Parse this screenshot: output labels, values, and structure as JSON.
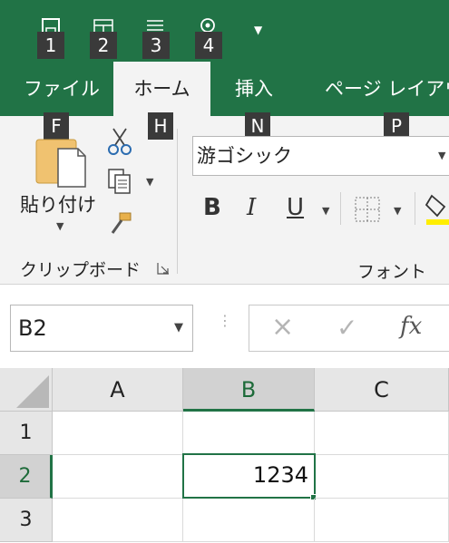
{
  "quick_access": {
    "icons": [
      "save-icon",
      "table-icon",
      "align-icon",
      "touch-mode-icon"
    ],
    "keytips": [
      "1",
      "2",
      "3",
      "4"
    ],
    "more_icon": "caret-down-icon"
  },
  "tabs": [
    {
      "label": "ファイル",
      "keytip": "F"
    },
    {
      "label": "ホーム",
      "keytip": "H"
    },
    {
      "label": "挿入",
      "keytip": "N"
    },
    {
      "label": "ページ レイアウ",
      "keytip": "P"
    }
  ],
  "ribbon": {
    "clipboard": {
      "paste_label": "貼り付け",
      "group_label": "クリップボード",
      "dialog_launcher_icon": "dialog-launcher-icon"
    },
    "font": {
      "font_name": "游ゴシック",
      "bold": "B",
      "italic": "I",
      "underline": "U",
      "group_label": "フォント"
    }
  },
  "formula_bar": {
    "name_box": "B2",
    "cancel_icon": "×",
    "enter_icon": "✓",
    "fx_label": "fx",
    "formula_value": ""
  },
  "grid": {
    "columns": [
      "A",
      "B",
      "C"
    ],
    "rows": [
      "1",
      "2",
      "3"
    ],
    "selected_column": "B",
    "selected_row": "2",
    "cells": {
      "B2": "1234"
    }
  },
  "colors": {
    "accent": "#217346",
    "ribbon_bg": "#f3f3f3",
    "keytip_bg": "#3a3a3a"
  }
}
